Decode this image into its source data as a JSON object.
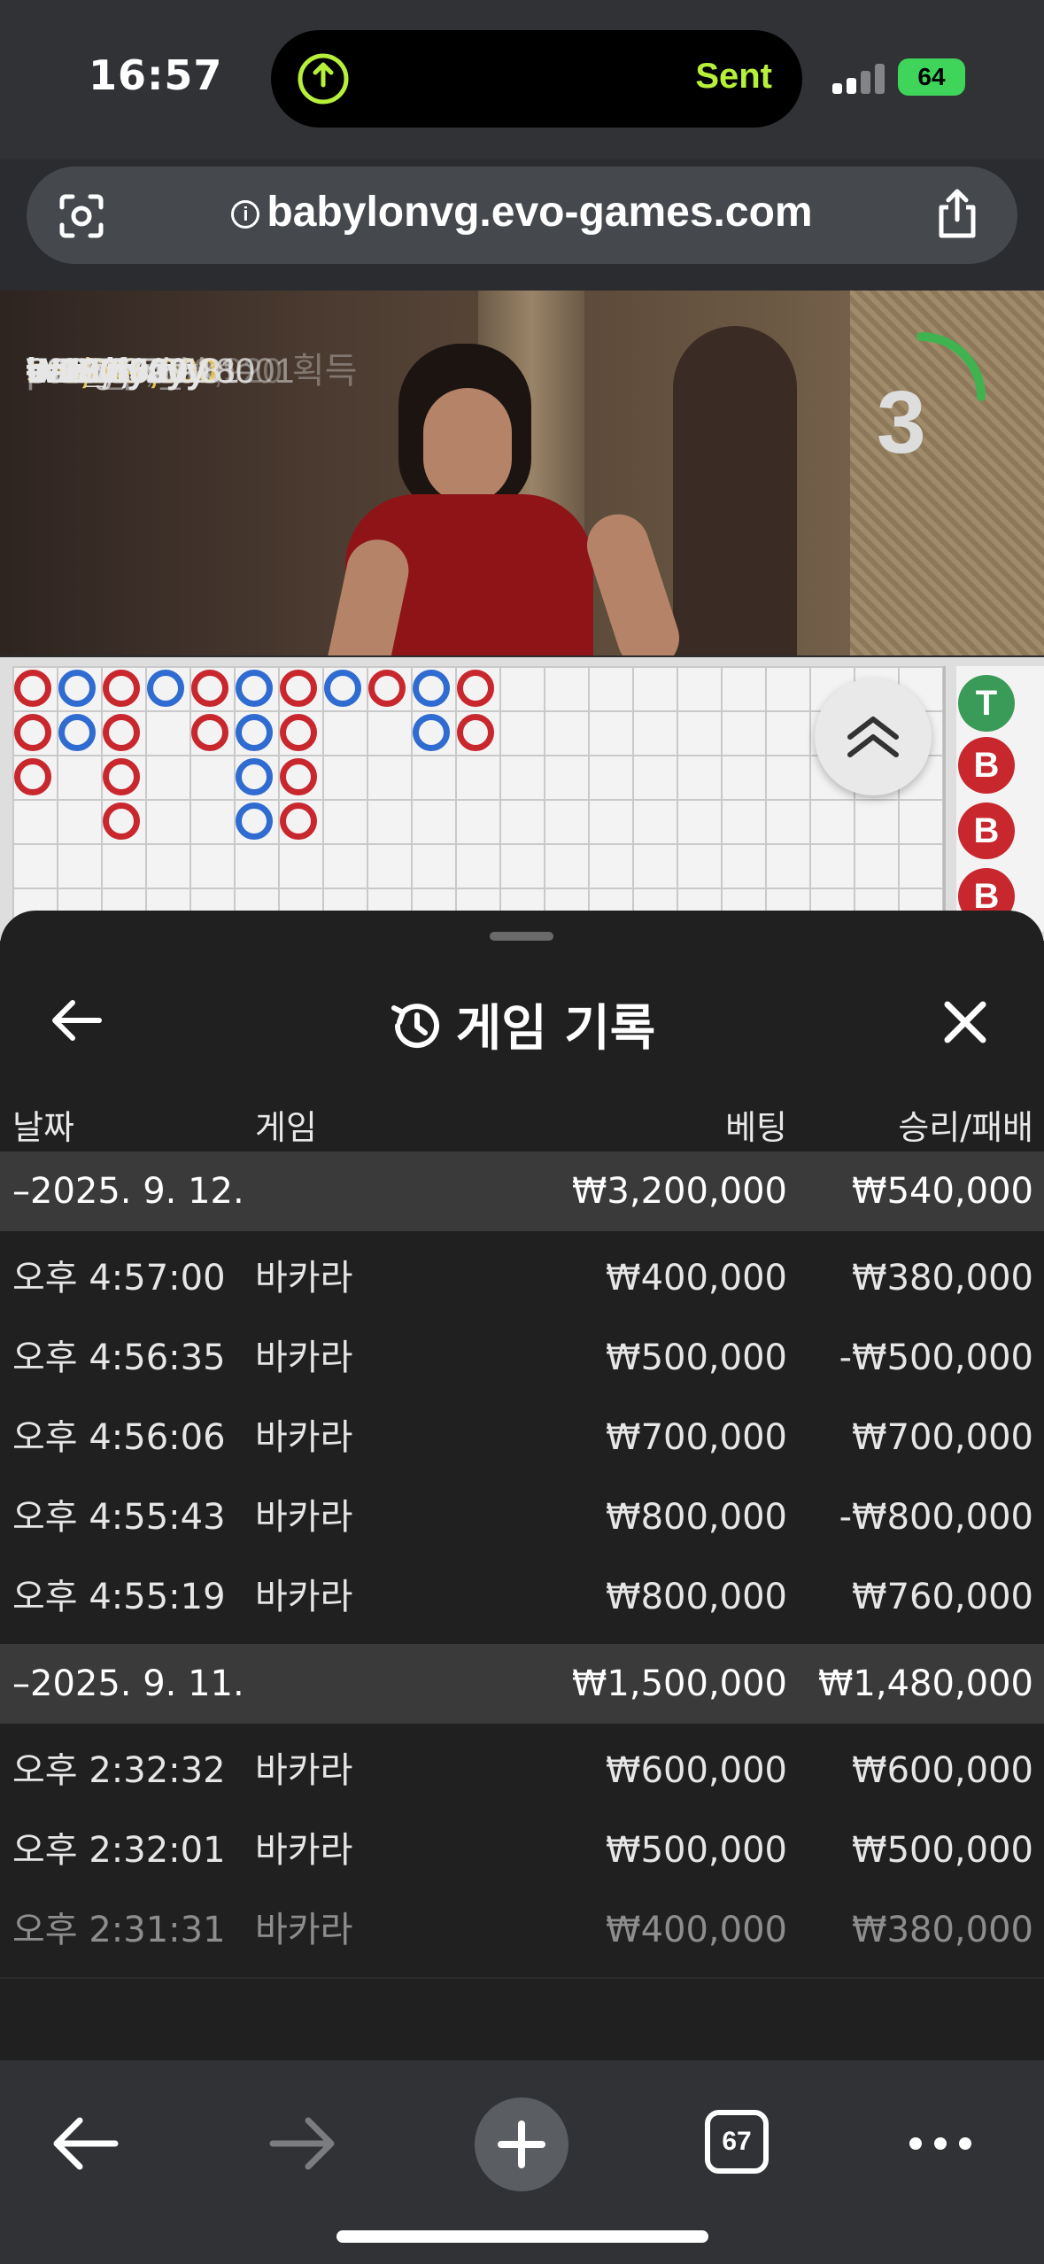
{
  "status_bar": {
    "time": "16:57",
    "activity_label": "Sent",
    "battery": "64"
  },
  "browser": {
    "url": "babylonvg.evo-games.com",
    "tab_count": "67"
  },
  "video": {
    "chat": [
      {
        "amount": "₩6,045,000",
        "user": "seok49"
      },
      {
        "amount": "₩780,000",
        "user": "baz_ifyayy"
      },
      {
        "amount": "₩487,500",
        "user": "lv777"
      },
      {
        "amount": "₩97,500",
        "user": "0001187518"
      },
      {
        "amount": "₩39,000",
        "user": "PLSgsw06180"
      },
      {
        "amount": "₩19,500",
        "user": "613667vita01"
      },
      {
        "amount": "₩19,500",
        "user": "pc19_pc_kkoe01"
      }
    ],
    "header_faded": "9 ▲₩7,508,920 획득",
    "countdown": "3"
  },
  "side_road": [
    "T",
    "B",
    "B",
    "B"
  ],
  "history": {
    "title": "게임 기록",
    "columns": {
      "date": "날짜",
      "game": "게임",
      "bet": "베팅",
      "winloss": "승리/패배"
    },
    "groups": [
      {
        "date": "–2025. 9. 12.",
        "bet_total": "₩3,200,000",
        "winloss_total": "₩540,000",
        "rows": [
          {
            "time": "오후 4:57:00",
            "game": "바카라",
            "bet": "₩400,000",
            "winloss": "₩380,000"
          },
          {
            "time": "오후 4:56:35",
            "game": "바카라",
            "bet": "₩500,000",
            "winloss": "-₩500,000"
          },
          {
            "time": "오후 4:56:06",
            "game": "바카라",
            "bet": "₩700,000",
            "winloss": "₩700,000"
          },
          {
            "time": "오후 4:55:43",
            "game": "바카라",
            "bet": "₩800,000",
            "winloss": "-₩800,000"
          },
          {
            "time": "오후 4:55:19",
            "game": "바카라",
            "bet": "₩800,000",
            "winloss": "₩760,000"
          }
        ]
      },
      {
        "date": "–2025. 9. 11.",
        "bet_total": "₩1,500,000",
        "winloss_total": "₩1,480,000",
        "rows": [
          {
            "time": "오후 2:32:32",
            "game": "바카라",
            "bet": "₩600,000",
            "winloss": "₩600,000"
          },
          {
            "time": "오후 2:32:01",
            "game": "바카라",
            "bet": "₩500,000",
            "winloss": "₩500,000"
          },
          {
            "time": "오후 2:31:31",
            "game": "바카라",
            "bet": "₩400,000",
            "winloss": "₩380,000"
          }
        ]
      }
    ]
  },
  "colors": {
    "banker_red": "#c8272d",
    "player_blue": "#2f6bd0",
    "tie_green": "#3a9a57",
    "sent_green": "#b7f03a"
  }
}
